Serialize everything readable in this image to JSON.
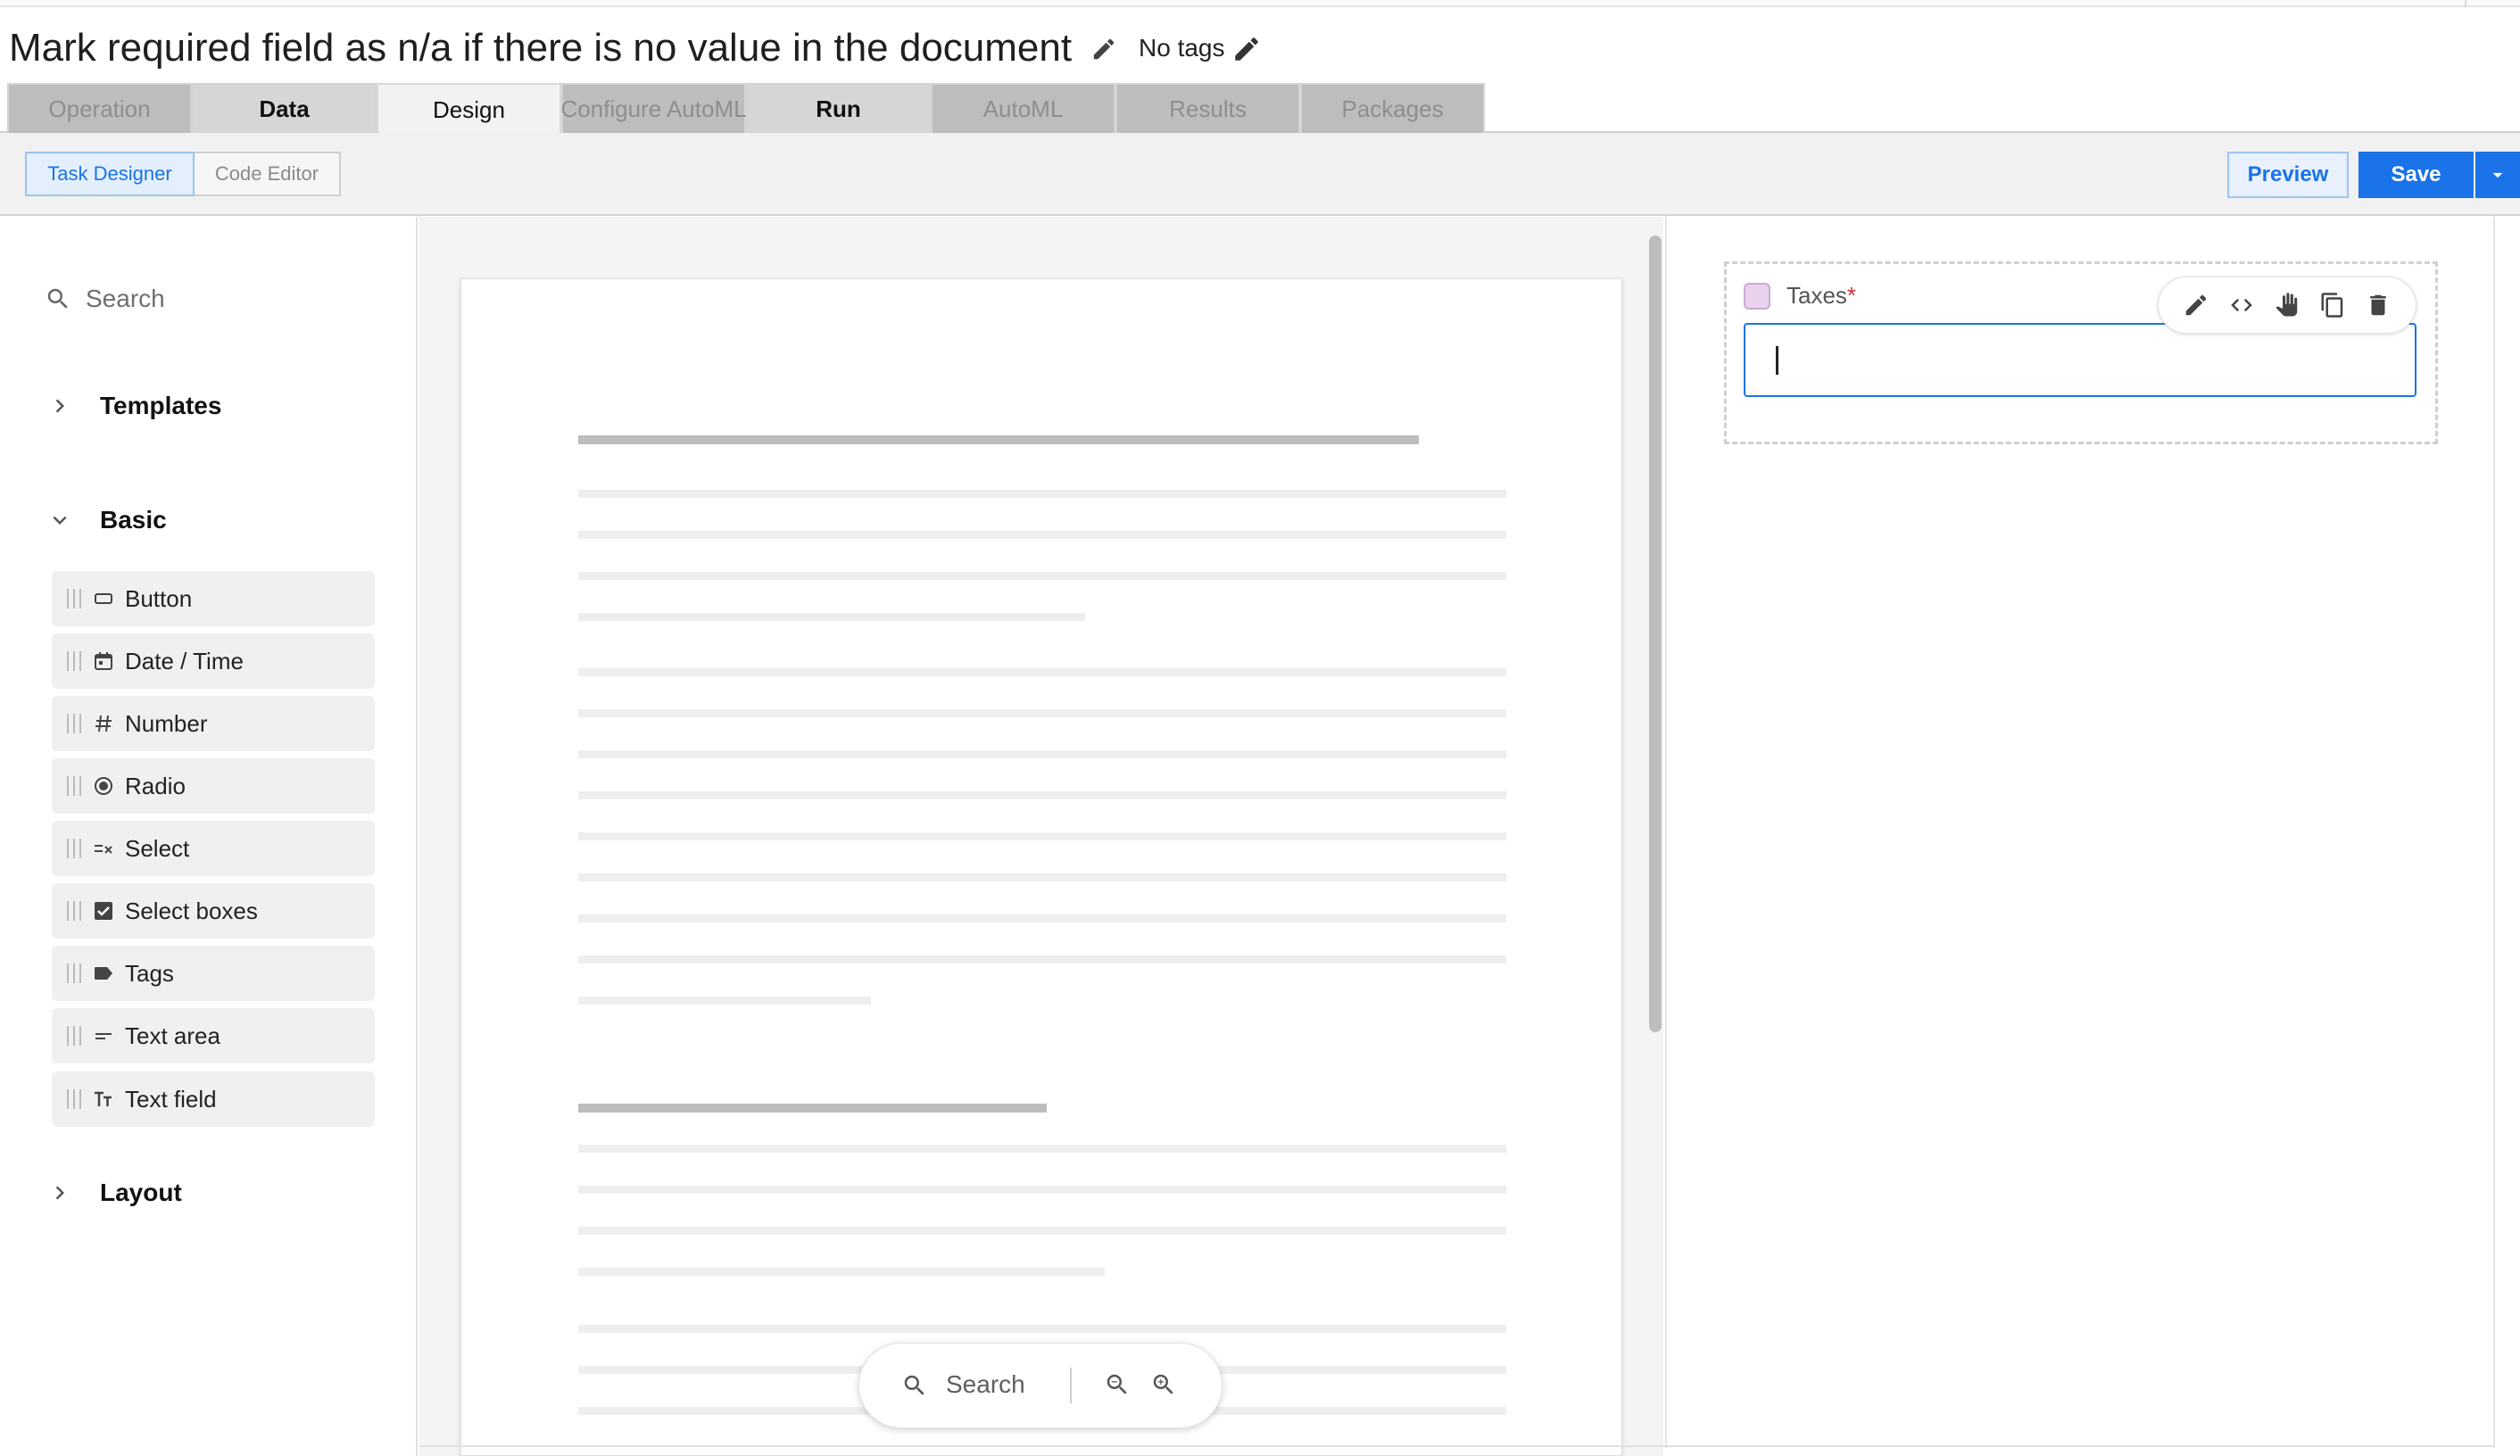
{
  "header": {
    "title": "Mark required field as n/a if there is no value in the document",
    "tags_label": "No tags"
  },
  "tabs": [
    {
      "label": "Operation",
      "state": "disabled"
    },
    {
      "label": "Data",
      "state": "enabled"
    },
    {
      "label": "Design",
      "state": "active"
    },
    {
      "label": "Configure AutoML",
      "state": "disabled"
    },
    {
      "label": "Run",
      "state": "enabled"
    },
    {
      "label": "AutoML",
      "state": "disabled"
    },
    {
      "label": "Results",
      "state": "disabled"
    },
    {
      "label": "Packages",
      "state": "disabled"
    }
  ],
  "toolbar": {
    "task_designer_label": "Task Designer",
    "code_editor_label": "Code Editor",
    "preview_label": "Preview",
    "save_label": "Save"
  },
  "sidebar": {
    "search_placeholder": "Search",
    "sections": {
      "templates": "Templates",
      "basic": "Basic",
      "layout": "Layout"
    },
    "components": [
      {
        "label": "Button",
        "icon": "button-icon"
      },
      {
        "label": "Date / Time",
        "icon": "calendar-icon"
      },
      {
        "label": "Number",
        "icon": "hash-icon"
      },
      {
        "label": "Radio",
        "icon": "radio-icon"
      },
      {
        "label": "Select",
        "icon": "select-icon"
      },
      {
        "label": "Select boxes",
        "icon": "checkbox-icon"
      },
      {
        "label": "Tags",
        "icon": "tag-icon"
      },
      {
        "label": "Text area",
        "icon": "text-area-icon"
      },
      {
        "label": "Text field",
        "icon": "text-field-icon"
      }
    ]
  },
  "document": {
    "search_label": "Search"
  },
  "form": {
    "field_label": "Taxes",
    "required_marker": "*",
    "field_value": ""
  },
  "colors": {
    "primary": "#1a73e8",
    "required": "#d32f2f",
    "field_swatch": "#e8d2ec"
  }
}
